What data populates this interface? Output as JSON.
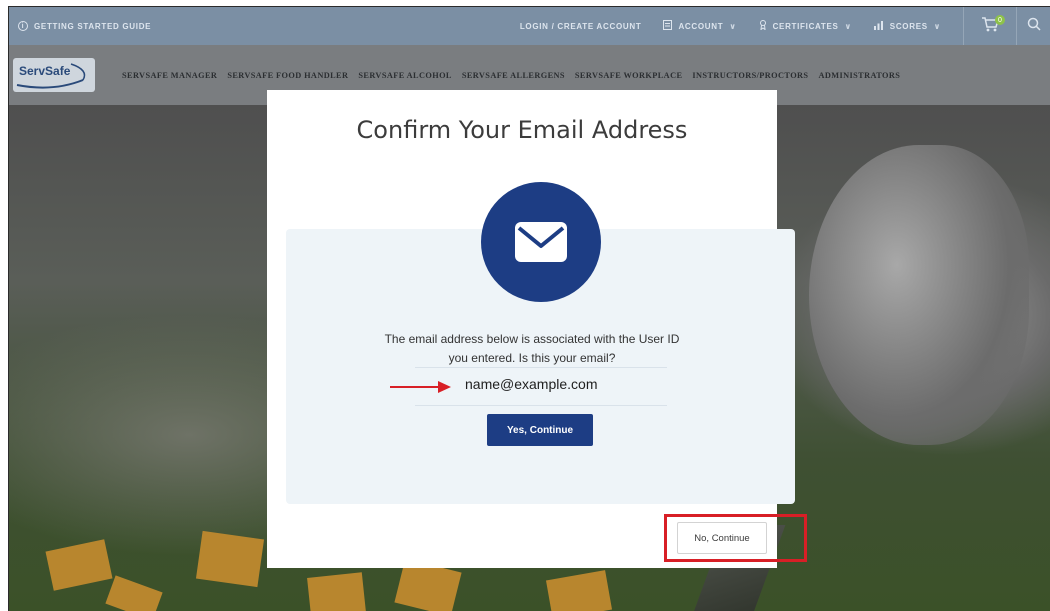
{
  "topbar": {
    "guide_label": "GETTING STARTED GUIDE",
    "login_label": "LOGIN / CREATE ACCOUNT",
    "account_label": "ACCOUNT",
    "certificates_label": "CERTIFICATES",
    "scores_label": "SCORES",
    "cart_count": "0"
  },
  "nav": {
    "logo_text": "ServSafe",
    "items": [
      "SERVSAFE MANAGER",
      "SERVSAFE FOOD HANDLER",
      "SERVSAFE ALCOHOL",
      "SERVSAFE ALLERGENS",
      "SERVSAFE WORKPLACE",
      "INSTRUCTORS/PROCTORS",
      "ADMINISTRATORS"
    ]
  },
  "modal": {
    "title": "Confirm Your Email Address",
    "message_line1": "The email address below is associated with the User ID",
    "message_line2": "you entered. Is this your email?",
    "email": "name@example.com",
    "yes_button": "Yes, Continue",
    "no_button": "No, Continue"
  },
  "colors": {
    "primary_blue": "#1d3d84",
    "annotation_red": "#d81f26",
    "panel_bg": "#eef4f8"
  }
}
